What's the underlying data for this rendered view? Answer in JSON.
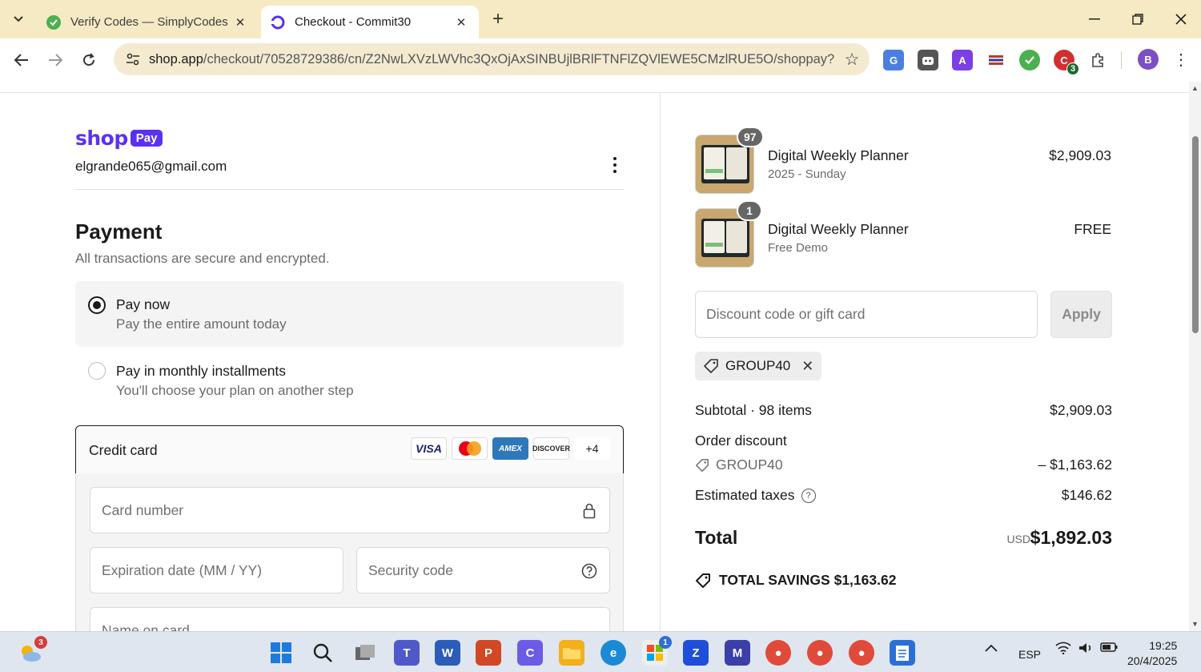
{
  "browser": {
    "tabs": [
      {
        "title": "Verify Codes — SimplyCodes",
        "active": false
      },
      {
        "title": "Checkout - Commit30",
        "active": true
      }
    ],
    "url_host": "shop.app",
    "url_path": "/checkout/70528729386/cn/Z2NwLXVzLWVhc3QxOjAxSINBUjlBRlFTNFlZQVlEWE5CMzlRUE5O/shoppay?re...",
    "extensions": [
      {
        "icon": "translate-icon",
        "color": "#4a7fe0"
      },
      {
        "icon": "robot-icon",
        "color": "#555555"
      },
      {
        "icon": "letter-a-icon",
        "color": "#7b3fe4"
      },
      {
        "icon": "flag-icon",
        "color": "#c0392b"
      },
      {
        "icon": "simplycodes-icon",
        "color": "#4caf50"
      },
      {
        "icon": "coupon-icon",
        "color": "#d32f2f",
        "badge": "3"
      },
      {
        "icon": "puzzle-icon",
        "color": "#444444"
      }
    ],
    "profile_initial": "B"
  },
  "left": {
    "brand_shop": "shop",
    "brand_pay": "Pay",
    "email": "elgrande065@gmail.com",
    "payment_heading": "Payment",
    "payment_sub": "All transactions are secure and encrypted.",
    "options": [
      {
        "title": "Pay now",
        "sub": "Pay the entire amount today",
        "selected": true
      },
      {
        "title": "Pay in monthly installments",
        "sub": "You'll choose your plan on another step",
        "selected": false
      }
    ],
    "credit_card_label": "Credit card",
    "card_brands": [
      "VISA",
      "AMEX",
      "DISCOVER",
      "+4"
    ],
    "fields": {
      "card_number": "Card number",
      "expiration": "Expiration date (MM / YY)",
      "security": "Security code",
      "name": "Name on card"
    }
  },
  "right": {
    "items": [
      {
        "name": "Digital Weekly Planner",
        "variant": "2025 - Sunday",
        "price": "$2,909.03",
        "qty": "97"
      },
      {
        "name": "Digital Weekly Planner",
        "variant": "Free Demo",
        "price": "FREE",
        "qty": "1"
      }
    ],
    "discount_placeholder": "Discount code or gift card",
    "apply_label": "Apply",
    "applied_code": "GROUP40",
    "subtotal_label": "Subtotal · 98 items",
    "subtotal_value": "$2,909.03",
    "order_discount_label": "Order discount",
    "discount_code": "GROUP40",
    "discount_value": "– $1,163.62",
    "taxes_label": "Estimated taxes",
    "taxes_value": "$146.62",
    "total_label": "Total",
    "total_currency": "USD",
    "total_value": "$1,892.03",
    "savings_label": "TOTAL SAVINGS $1,163.62"
  },
  "taskbar": {
    "weather_badge": "3",
    "store_badge": "1",
    "language": "ESP",
    "time": "19:25",
    "date": "20/4/2025"
  }
}
